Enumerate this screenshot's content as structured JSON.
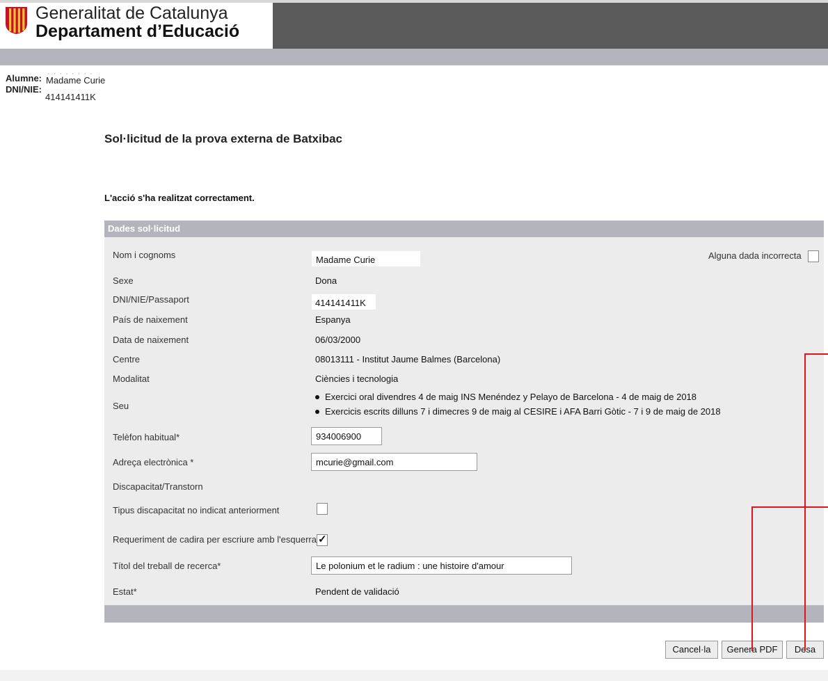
{
  "header": {
    "government": "Generalitat de Catalunya",
    "department": "Departament d’Educació"
  },
  "student": {
    "alumne_label": "Alumne:",
    "alumne_value": "Madame Curie",
    "dni_label": "DNI/NIE:",
    "dni_value": "414141411K"
  },
  "page_title": "Sol·licitud de la prova externa de Batxibac",
  "success_message": "L'acció s'ha realitzat correctament.",
  "section": {
    "title": "Dades sol·licitud",
    "incorrect_data_label": "Alguna dada incorrecta",
    "fields": {
      "nom_label": "Nom i cognoms",
      "nom_value": "Madame Curie",
      "sexe_label": "Sexe",
      "sexe_value": "Dona",
      "dni_label": "DNI/NIE/Passaport",
      "dni_value": "414141411K",
      "pais_label": "País de naixement",
      "pais_value": "Espanya",
      "data_label": "Data de naixement",
      "data_value": "06/03/2000",
      "centre_label": "Centre",
      "centre_value": "08013111 - Institut Jaume Balmes (Barcelona)",
      "modalitat_label": "Modalitat",
      "modalitat_value": "Ciències i tecnologia",
      "seu_label": "Seu",
      "seu_items": [
        "Exercici oral divendres 4 de maig INS Menéndez y Pelayo de Barcelona - 4 de maig de 2018",
        "Exercicis escrits dilluns 7 i dimecres 9 de maig al CESIRE i AFA Barri Gòtic - 7 i 9 de maig de 2018"
      ],
      "telefon_label": "Telèfon habitual*",
      "telefon_value": "934006900",
      "email_label": "Adreça electrònica *",
      "email_value": "mcurie@gmail.com",
      "discapacitat_label": "Discapacitat/Transtorn",
      "tipus_label": "Tipus discapacitat no indicat anteriorment",
      "tipus_checked": false,
      "cadira_label": "Requeriment de cadira per escriure amb l'esquerra",
      "cadira_checked": true,
      "titol_label": "Títol del treball de recerca*",
      "titol_value": "Le polonium et le radium : une histoire d'amour",
      "estat_label": "Estat*",
      "estat_value": "Pendent de validació"
    }
  },
  "buttons": {
    "cancel": "Cancel·la",
    "pdf": "Genera PDF",
    "save": "Desa"
  },
  "colors": {
    "header_dark": "#5a5a5a",
    "bar_gray": "#b4b4bc",
    "form_bg": "#ececec",
    "annotation_red": "#e0141e",
    "logo_red": "#c8102e",
    "logo_yellow": "#f2c230"
  }
}
